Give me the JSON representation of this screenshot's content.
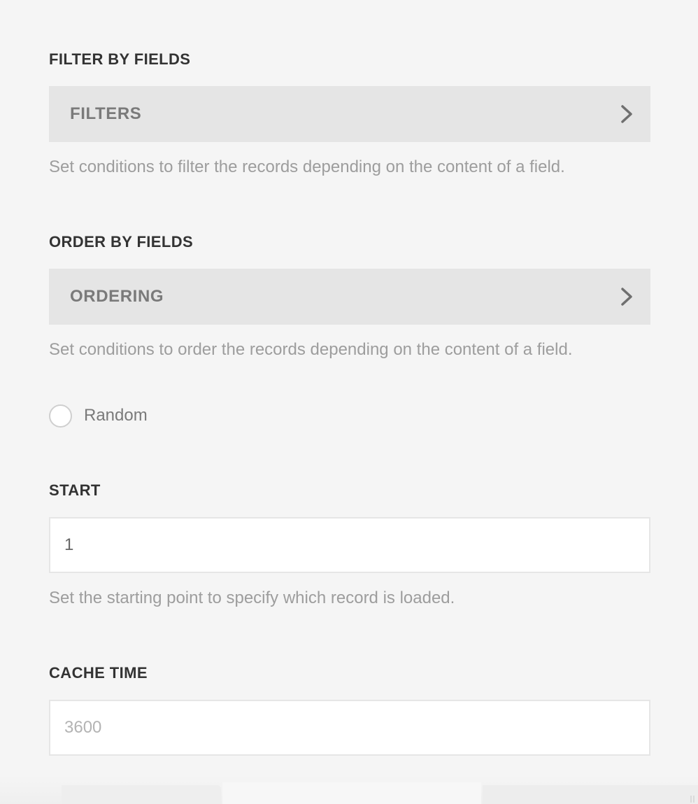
{
  "filter_section": {
    "title": "FILTER BY FIELDS",
    "button_label": "FILTERS",
    "help": "Set conditions to filter the records depending on the content of a field."
  },
  "order_section": {
    "title": "ORDER BY FIELDS",
    "button_label": "ORDERING",
    "help": "Set conditions to order the records depending on the content of a field.",
    "random_label": "Random",
    "random_checked": false
  },
  "start_section": {
    "title": "START",
    "value": "1",
    "help": "Set the starting point to specify which record is loaded."
  },
  "cache_section": {
    "title": "CACHE TIME",
    "value": "",
    "placeholder": "3600"
  },
  "icons": {
    "nav_chevron": "chevron-right-icon",
    "resize": "resize-grip-icon"
  },
  "colors": {
    "background": "#f5f5f5",
    "nav_bar": "#e5e5e5",
    "heading": "#333333",
    "help_text": "#9d9d9d"
  }
}
